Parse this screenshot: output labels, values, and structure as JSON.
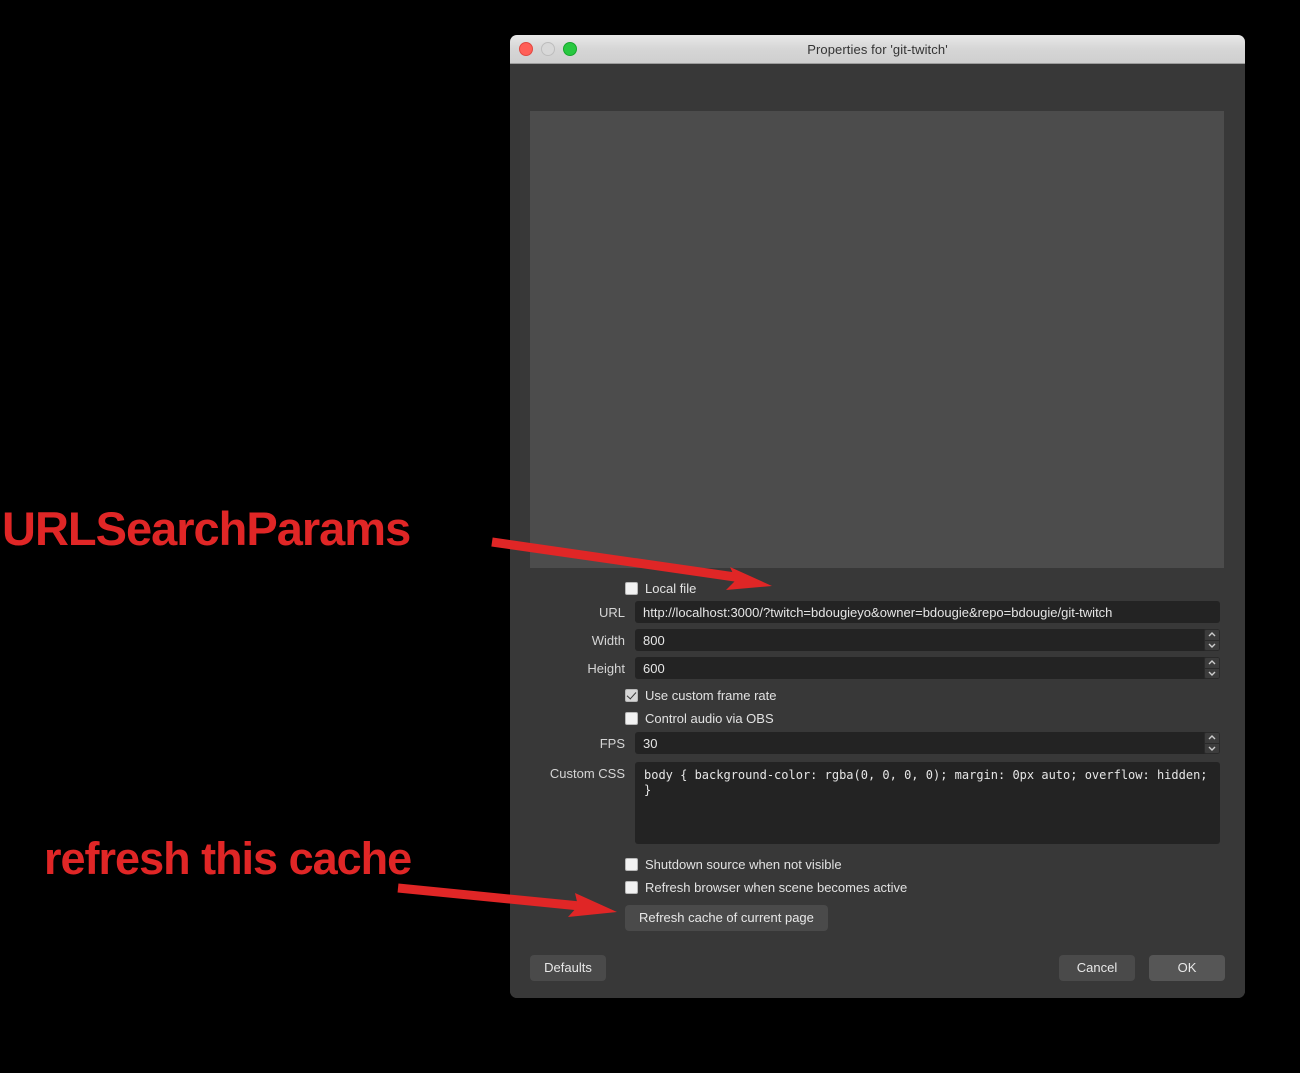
{
  "window": {
    "title": "Properties for 'git-twitch'",
    "traffic_lights": [
      "close-red",
      "minimize-grey",
      "zoom-green"
    ]
  },
  "form": {
    "local_file": {
      "label": "Local file",
      "checked": false
    },
    "url": {
      "label": "URL",
      "value": "http://localhost:3000/?twitch=bdougieyo&owner=bdougie&repo=bdougie/git-twitch"
    },
    "width": {
      "label": "Width",
      "value": "800"
    },
    "height": {
      "label": "Height",
      "value": "600"
    },
    "use_custom_frame_rate": {
      "label": "Use custom frame rate",
      "checked": true
    },
    "control_audio_via_obs": {
      "label": "Control audio via OBS",
      "checked": false
    },
    "fps": {
      "label": "FPS",
      "value": "30"
    },
    "custom_css": {
      "label": "Custom CSS",
      "value": "body { background-color: rgba(0, 0, 0, 0); margin: 0px auto; overflow: hidden; }"
    },
    "shutdown_source": {
      "label": "Shutdown source when not visible",
      "checked": false
    },
    "refresh_browser": {
      "label": "Refresh browser when scene becomes active",
      "checked": false
    },
    "refresh_cache_button": "Refresh cache of current page"
  },
  "footer": {
    "defaults": "Defaults",
    "cancel": "Cancel",
    "ok": "OK"
  },
  "annotations": {
    "urlsearchparams": "URLSearchParams",
    "refresh_this_cache": "refresh this cache",
    "color": "#e02626"
  }
}
